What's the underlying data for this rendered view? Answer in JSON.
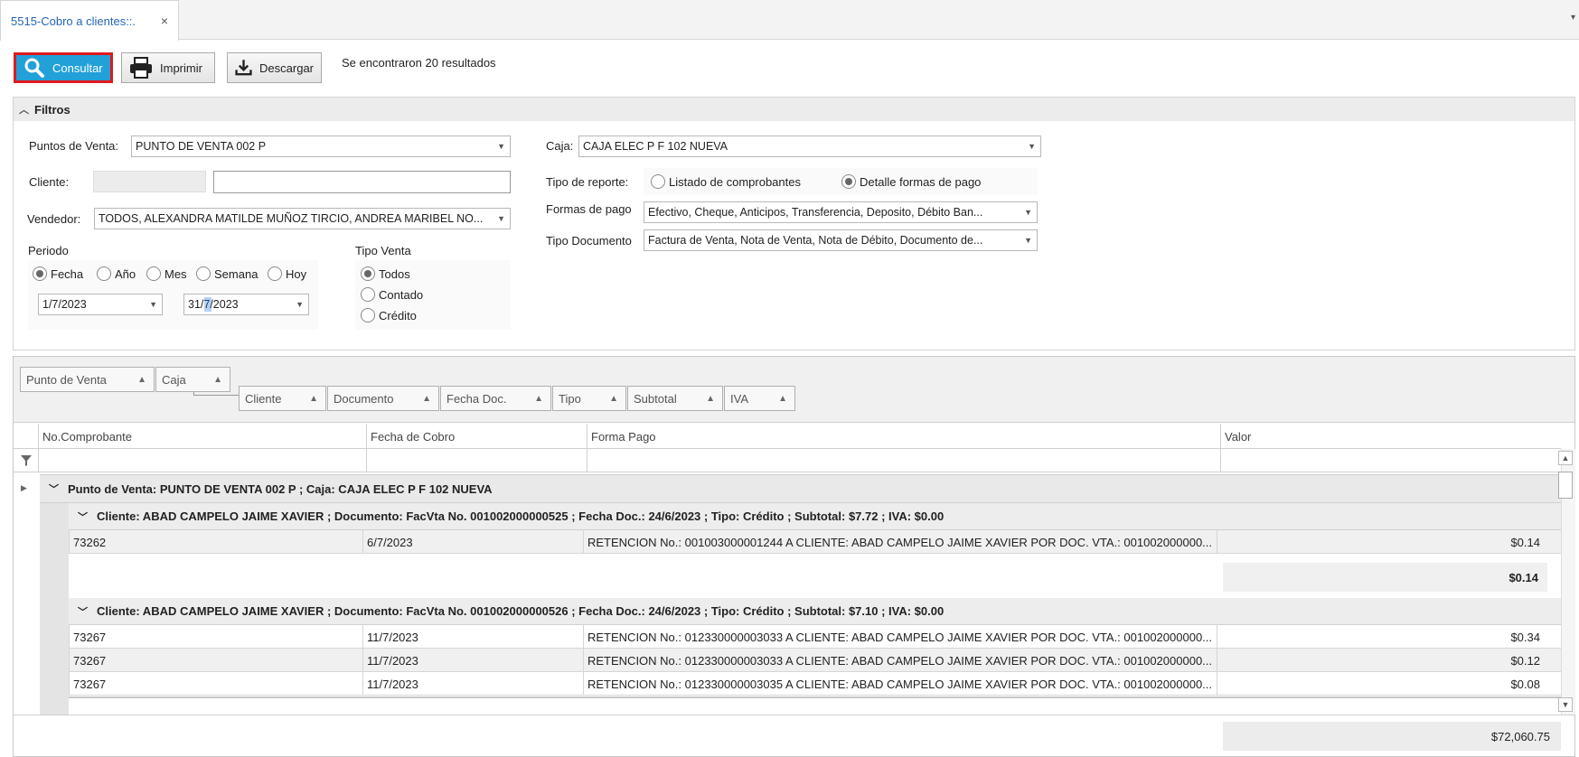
{
  "tab": {
    "title": "5515-Cobro a clientes::.",
    "close": "×"
  },
  "toolbar": {
    "consultar": "Consultar",
    "imprimir": "Imprimir",
    "descargar": "Descargar",
    "results_text": "Se encontraron 20 resultados"
  },
  "filters": {
    "header": "Filtros",
    "puntos_label": "Puntos de Venta:",
    "puntos_value": "PUNTO DE VENTA 002 P",
    "caja_label": "Caja:",
    "caja_value": "CAJA ELEC P F 102 NUEVA",
    "cliente_label": "Cliente:",
    "cliente_code": "",
    "cliente_name": "",
    "vendedor_label": "Vendedor:",
    "vendedor_value": "TODOS, ALEXANDRA MATILDE MUÑOZ TIRCIO, ANDREA MARIBEL NO...",
    "tipo_reporte_label": "Tipo de reporte:",
    "tipo_reporte_opt1": "Listado de comprobantes",
    "tipo_reporte_opt2": "Detalle formas de pago",
    "formas_pago_label": "Formas de pago",
    "formas_pago_value": "Efectivo, Cheque, Anticipos, Transferencia, Deposito, Débito Ban...",
    "tipo_doc_label": "Tipo Documento",
    "tipo_doc_value": "Factura de Venta, Nota de Venta, Nota de Débito, Documento de...",
    "periodo_label": "Periodo",
    "periodo_opts": [
      "Fecha",
      "Año",
      "Mes",
      "Semana",
      "Hoy"
    ],
    "fecha_desde": "1/7/2023",
    "fecha_hasta": "31/7/2023",
    "tipo_venta_label": "Tipo Venta",
    "tipo_venta_opts": [
      "Todos",
      "Contado",
      "Crédito"
    ]
  },
  "grouping": {
    "chips": [
      "Punto de Venta",
      "Caja",
      "Cliente",
      "Documento",
      "Fecha Doc.",
      "Tipo",
      "Subtotal",
      "IVA"
    ]
  },
  "columns": [
    "No.Comprobante",
    "Fecha de Cobro",
    "Forma Pago",
    "Valor"
  ],
  "group1": {
    "text": "Punto de Venta: PUNTO DE VENTA 002 P ; Caja: CAJA ELEC P F 102 NUEVA"
  },
  "groupA": {
    "text": "Cliente: ABAD CAMPELO JAIME XAVIER ; Documento: FacVta No. 001002000000525 ; Fecha Doc.: 24/6/2023 ; Tipo: Crédito ; Subtotal: $7.72 ; IVA: $0.00",
    "rows": [
      {
        "comprobante": "73262",
        "fecha": "6/7/2023",
        "forma": "RETENCION No.: 001003000001244 A CLIENTE: ABAD CAMPELO JAIME XAVIER POR DOC. VTA.: 001002000000...",
        "valor": "$0.14"
      }
    ],
    "subtotal": "$0.14"
  },
  "groupB": {
    "text": "Cliente: ABAD CAMPELO JAIME XAVIER ; Documento: FacVta No. 001002000000526 ; Fecha Doc.: 24/6/2023 ; Tipo: Crédito ; Subtotal: $7.10 ; IVA: $0.00",
    "rows": [
      {
        "comprobante": "73267",
        "fecha": "11/7/2023",
        "forma": "RETENCION No.: 012330000003033 A CLIENTE: ABAD CAMPELO JAIME XAVIER POR DOC. VTA.: 001002000000...",
        "valor": "$0.34"
      },
      {
        "comprobante": "73267",
        "fecha": "11/7/2023",
        "forma": "RETENCION No.: 012330000003033 A CLIENTE: ABAD CAMPELO JAIME XAVIER POR DOC. VTA.: 001002000000...",
        "valor": "$0.12"
      },
      {
        "comprobante": "73267",
        "fecha": "11/7/2023",
        "forma": "RETENCION No.: 012330000003035 A CLIENTE: ABAD CAMPELO JAIME XAVIER POR DOC. VTA.: 001002000000...",
        "valor": "$0.08"
      }
    ]
  },
  "grand_total": "$72,060.75"
}
